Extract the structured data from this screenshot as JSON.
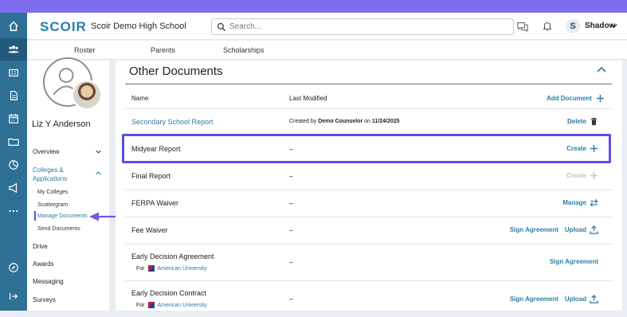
{
  "header": {
    "logo": "SCOIR",
    "school": "Scoir Demo High School",
    "search_placeholder": "Search...",
    "user_initial": "S",
    "user_name": "Shadow"
  },
  "subnav": [
    "Roster",
    "Parents",
    "Scholarships"
  ],
  "student": {
    "name": "Liz Y Anderson"
  },
  "leftnav": {
    "overview": "Overview",
    "colleges_line1": "Colleges &",
    "colleges_line2": "Applications",
    "sub_items": [
      "My Colleges",
      "Scattergram",
      "Manage Documents",
      "Send Documents"
    ],
    "items": [
      "Drive",
      "Awards",
      "Messaging",
      "Surveys"
    ]
  },
  "documents": {
    "title": "Other Documents",
    "col_name": "Name",
    "col_modified": "Last Modified",
    "add_label": "Add Document",
    "rows": [
      {
        "name": "Secondary School Report",
        "prefix": "Created by ",
        "by": "Demo Counselor",
        "on_text": " on ",
        "date": "11/24/2025",
        "actions": [
          "Delete"
        ]
      },
      {
        "name": "Midyear Report",
        "modified": "–",
        "actions": [
          "Create"
        ]
      },
      {
        "name": "Final Report",
        "modified": "–",
        "actions": [
          "Create"
        ]
      },
      {
        "name": "FERPA Waiver",
        "modified": "–",
        "actions": [
          "Manage"
        ]
      },
      {
        "name": "Fee Waiver",
        "modified": "–",
        "actions": [
          "Sign Agreement",
          "Upload"
        ]
      },
      {
        "name": "Early Decision Agreement",
        "for_label": "For",
        "university": "American University",
        "modified": "–",
        "actions": [
          "Sign Agreement"
        ]
      },
      {
        "name": "Early Decision Contract",
        "for_label": "For",
        "university": "American University",
        "modified": "–",
        "actions": [
          "Sign Agreement",
          "Upload"
        ]
      }
    ]
  },
  "colors": {
    "accent": "#2d7da7",
    "rail": "#2f7096",
    "highlight": "#5b4ee6",
    "topstrip": "#7f6df0"
  }
}
